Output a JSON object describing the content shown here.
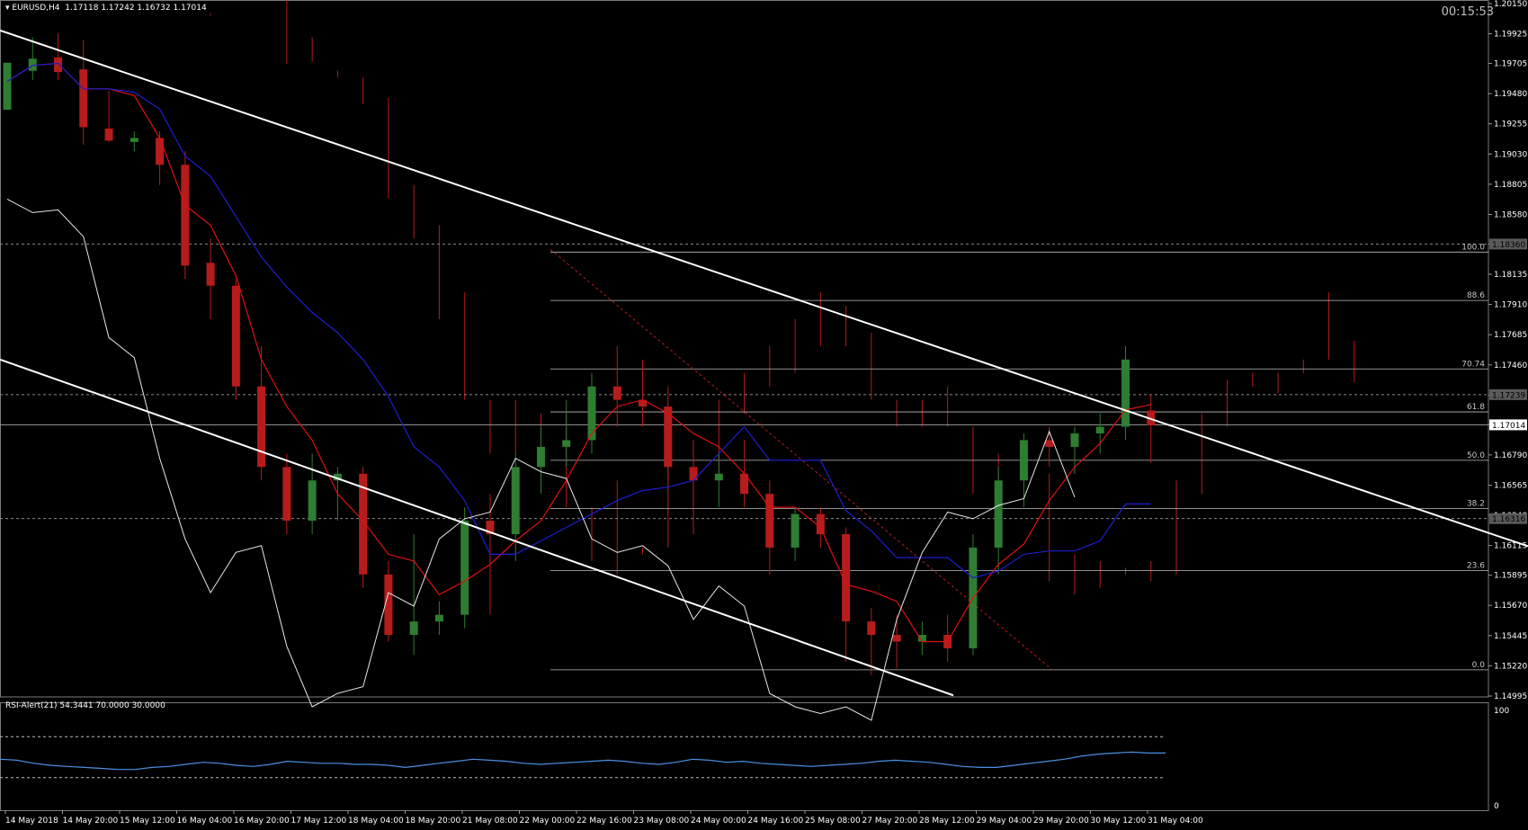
{
  "header": {
    "symbol": "EURUSD,H4",
    "ohlc": "1.17118 1.17242 1.16732 1.17014",
    "timer": "00:15:53"
  },
  "rsi_header": "RSI-Alert(21) 54.3441 70.0000 30.0000",
  "colors": {
    "background": "#000000",
    "bull": "#2f7d32",
    "bear": "#b71c1c",
    "tenkan": "#e01010",
    "kijun": "#1e1ed0",
    "chikou": "#e6e6e6",
    "cloud": "#b71c1c",
    "trendline": "#ffffff",
    "rsi": "#4a90e2",
    "fib": "#bdbdbd"
  },
  "chart_data": [
    {
      "type": "candlestick",
      "title": "EURUSD,H4",
      "ylim": [
        1.14995,
        1.2015
      ],
      "y_ticks": [
        "1.20150",
        "1.19925",
        "1.19705",
        "1.19480",
        "1.19255",
        "1.19030",
        "1.18805",
        "1.18580",
        "1.18360",
        "1.18135",
        "1.17910",
        "1.17685",
        "1.17460",
        "1.17235",
        "1.17014",
        "1.16790",
        "1.16565",
        "1.16340",
        "1.16115",
        "1.15895",
        "1.15670",
        "1.15445",
        "1.15220",
        "1.14995"
      ],
      "y_tick_values": [
        1.2015,
        1.19925,
        1.19705,
        1.1948,
        1.19255,
        1.1903,
        1.18805,
        1.1858,
        1.1836,
        1.18135,
        1.1791,
        1.17685,
        1.1746,
        1.17235,
        1.17014,
        1.1679,
        1.16565,
        1.1634,
        1.16115,
        1.15895,
        1.1567,
        1.15445,
        1.1522,
        1.14995
      ],
      "x_labels": [
        "14 May 2018",
        "14 May 20:00",
        "15 May 12:00",
        "16 May 04:00",
        "16 May 20:00",
        "17 May 12:00",
        "18 May 04:00",
        "18 May 20:00",
        "21 May 08:00",
        "22 May 00:00",
        "22 May 16:00",
        "23 May 08:00",
        "24 May 00:00",
        "24 May 16:00",
        "25 May 08:00",
        "27 May 20:00",
        "28 May 12:00",
        "29 May 04:00",
        "29 May 20:00",
        "30 May 12:00",
        "31 May 04:00"
      ],
      "price_labels": [
        {
          "text": "1.18360",
          "value": 1.1836
        },
        {
          "text": "1.17239",
          "value": 1.17239
        },
        {
          "text": "1.17014",
          "value": 1.17014
        },
        {
          "text": "1.16316",
          "value": 1.16316
        }
      ],
      "fibonacci": [
        {
          "level": "100.0",
          "price": 1.183
        },
        {
          "level": "88.6",
          "price": 1.1794
        },
        {
          "level": "70.74",
          "price": 1.1743
        },
        {
          "level": "61.8",
          "price": 1.1711
        },
        {
          "level": "50.0",
          "price": 1.1675
        },
        {
          "level": "38.2",
          "price": 1.1639
        },
        {
          "level": "23.6",
          "price": 1.1593
        },
        {
          "level": "0.0",
          "price": 1.1519
        }
      ],
      "candles": [
        [
          1.1936,
          1.1966,
          1.1948,
          1.1971
        ],
        [
          1.1965,
          1.199,
          1.1958,
          1.1974
        ],
        [
          1.1975,
          1.1993,
          1.1958,
          1.1964
        ],
        [
          1.1966,
          1.1988,
          1.191,
          1.1923
        ],
        [
          1.1922,
          1.195,
          1.1912,
          1.1913
        ],
        [
          1.1912,
          1.192,
          1.1905,
          1.1915
        ],
        [
          1.1915,
          1.192,
          1.188,
          1.1895
        ],
        [
          1.1895,
          1.1905,
          1.181,
          1.182
        ],
        [
          1.1822,
          1.184,
          1.178,
          1.1805
        ],
        [
          1.1805,
          1.181,
          1.172,
          1.173
        ],
        [
          1.173,
          1.176,
          1.166,
          1.167
        ],
        [
          1.167,
          1.168,
          1.162,
          1.163
        ],
        [
          1.163,
          1.168,
          1.162,
          1.166
        ],
        [
          1.166,
          1.167,
          1.163,
          1.1665
        ],
        [
          1.1665,
          1.167,
          1.158,
          1.159
        ],
        [
          1.159,
          1.16,
          1.154,
          1.1545
        ],
        [
          1.1545,
          1.162,
          1.153,
          1.1555
        ],
        [
          1.1555,
          1.157,
          1.1545,
          1.156
        ],
        [
          1.156,
          1.164,
          1.155,
          1.163
        ],
        [
          1.163,
          1.165,
          1.156,
          1.162
        ],
        [
          1.162,
          1.168,
          1.16,
          1.167
        ],
        [
          1.167,
          1.17,
          1.165,
          1.1685
        ],
        [
          1.1685,
          1.172,
          1.167,
          1.169
        ],
        [
          1.169,
          1.174,
          1.168,
          1.173
        ],
        [
          1.173,
          1.176,
          1.17,
          1.172
        ],
        [
          1.172,
          1.175,
          1.17,
          1.1715
        ],
        [
          1.1715,
          1.173,
          1.166,
          1.167
        ],
        [
          1.167,
          1.168,
          1.164,
          1.166
        ],
        [
          1.166,
          1.168,
          1.164,
          1.1665
        ],
        [
          1.1665,
          1.169,
          1.164,
          1.165
        ],
        [
          1.165,
          1.166,
          1.159,
          1.161
        ],
        [
          1.161,
          1.164,
          1.16,
          1.1635
        ],
        [
          1.1635,
          1.164,
          1.161,
          1.162
        ],
        [
          1.162,
          1.1625,
          1.1525,
          1.1555
        ],
        [
          1.1555,
          1.1565,
          1.1515,
          1.1545
        ],
        [
          1.1545,
          1.156,
          1.152,
          1.154
        ],
        [
          1.154,
          1.1555,
          1.153,
          1.1545
        ],
        [
          1.1545,
          1.156,
          1.1525,
          1.1535
        ],
        [
          1.1535,
          1.162,
          1.153,
          1.161
        ],
        [
          1.161,
          1.167,
          1.159,
          1.166
        ],
        [
          1.166,
          1.1695,
          1.164,
          1.169
        ],
        [
          1.169,
          1.17,
          1.167,
          1.1685
        ],
        [
          1.1685,
          1.17,
          1.1665,
          1.1695
        ],
        [
          1.1695,
          1.171,
          1.168,
          1.17
        ],
        [
          1.17,
          1.176,
          1.169,
          1.175
        ],
        [
          1.1712,
          1.1724,
          1.1673,
          1.1701
        ]
      ],
      "rsi": {
        "ylim": [
          0,
          100
        ],
        "y_ticks": [
          "100",
          "0"
        ],
        "levels": [
          70,
          30
        ],
        "values": [
          48,
          47,
          44,
          42,
          41,
          40,
          39,
          38,
          38,
          40,
          41,
          43,
          45,
          44,
          42,
          41,
          43,
          46,
          45,
          44,
          44,
          43,
          43,
          42,
          40,
          42,
          44,
          46,
          48,
          47,
          46,
          44,
          43,
          44,
          45,
          46,
          47,
          46,
          44,
          43,
          45,
          48,
          47,
          45,
          46,
          44,
          43,
          42,
          41,
          42,
          43,
          44,
          46,
          47,
          46,
          45,
          43,
          41,
          40,
          40,
          42,
          44,
          46,
          48,
          51,
          53,
          54,
          55,
          54,
          54
        ]
      }
    }
  ]
}
